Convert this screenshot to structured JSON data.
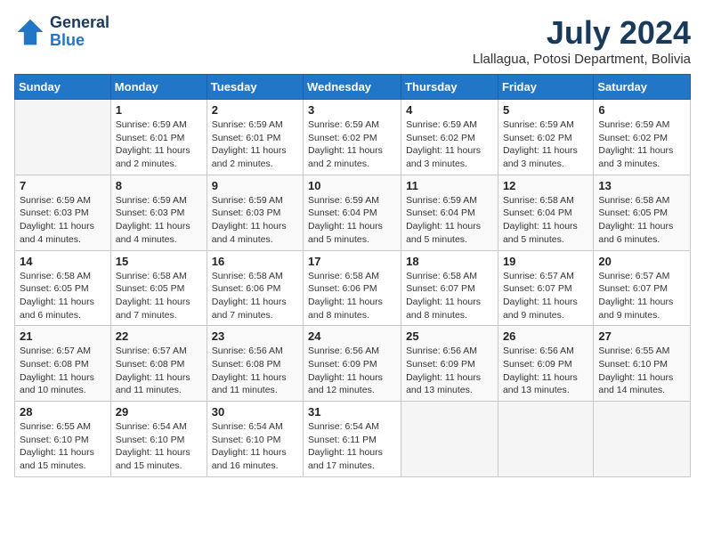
{
  "header": {
    "logo_general": "General",
    "logo_blue": "Blue",
    "month_title": "July 2024",
    "location": "Llallagua, Potosi Department, Bolivia"
  },
  "days_of_week": [
    "Sunday",
    "Monday",
    "Tuesday",
    "Wednesday",
    "Thursday",
    "Friday",
    "Saturday"
  ],
  "weeks": [
    [
      {
        "day": "",
        "info": ""
      },
      {
        "day": "1",
        "info": "Sunrise: 6:59 AM\nSunset: 6:01 PM\nDaylight: 11 hours\nand 2 minutes."
      },
      {
        "day": "2",
        "info": "Sunrise: 6:59 AM\nSunset: 6:01 PM\nDaylight: 11 hours\nand 2 minutes."
      },
      {
        "day": "3",
        "info": "Sunrise: 6:59 AM\nSunset: 6:02 PM\nDaylight: 11 hours\nand 2 minutes."
      },
      {
        "day": "4",
        "info": "Sunrise: 6:59 AM\nSunset: 6:02 PM\nDaylight: 11 hours\nand 3 minutes."
      },
      {
        "day": "5",
        "info": "Sunrise: 6:59 AM\nSunset: 6:02 PM\nDaylight: 11 hours\nand 3 minutes."
      },
      {
        "day": "6",
        "info": "Sunrise: 6:59 AM\nSunset: 6:02 PM\nDaylight: 11 hours\nand 3 minutes."
      }
    ],
    [
      {
        "day": "7",
        "info": "Sunrise: 6:59 AM\nSunset: 6:03 PM\nDaylight: 11 hours\nand 4 minutes."
      },
      {
        "day": "8",
        "info": "Sunrise: 6:59 AM\nSunset: 6:03 PM\nDaylight: 11 hours\nand 4 minutes."
      },
      {
        "day": "9",
        "info": "Sunrise: 6:59 AM\nSunset: 6:03 PM\nDaylight: 11 hours\nand 4 minutes."
      },
      {
        "day": "10",
        "info": "Sunrise: 6:59 AM\nSunset: 6:04 PM\nDaylight: 11 hours\nand 5 minutes."
      },
      {
        "day": "11",
        "info": "Sunrise: 6:59 AM\nSunset: 6:04 PM\nDaylight: 11 hours\nand 5 minutes."
      },
      {
        "day": "12",
        "info": "Sunrise: 6:58 AM\nSunset: 6:04 PM\nDaylight: 11 hours\nand 5 minutes."
      },
      {
        "day": "13",
        "info": "Sunrise: 6:58 AM\nSunset: 6:05 PM\nDaylight: 11 hours\nand 6 minutes."
      }
    ],
    [
      {
        "day": "14",
        "info": "Sunrise: 6:58 AM\nSunset: 6:05 PM\nDaylight: 11 hours\nand 6 minutes."
      },
      {
        "day": "15",
        "info": "Sunrise: 6:58 AM\nSunset: 6:05 PM\nDaylight: 11 hours\nand 7 minutes."
      },
      {
        "day": "16",
        "info": "Sunrise: 6:58 AM\nSunset: 6:06 PM\nDaylight: 11 hours\nand 7 minutes."
      },
      {
        "day": "17",
        "info": "Sunrise: 6:58 AM\nSunset: 6:06 PM\nDaylight: 11 hours\nand 8 minutes."
      },
      {
        "day": "18",
        "info": "Sunrise: 6:58 AM\nSunset: 6:07 PM\nDaylight: 11 hours\nand 8 minutes."
      },
      {
        "day": "19",
        "info": "Sunrise: 6:57 AM\nSunset: 6:07 PM\nDaylight: 11 hours\nand 9 minutes."
      },
      {
        "day": "20",
        "info": "Sunrise: 6:57 AM\nSunset: 6:07 PM\nDaylight: 11 hours\nand 9 minutes."
      }
    ],
    [
      {
        "day": "21",
        "info": "Sunrise: 6:57 AM\nSunset: 6:08 PM\nDaylight: 11 hours\nand 10 minutes."
      },
      {
        "day": "22",
        "info": "Sunrise: 6:57 AM\nSunset: 6:08 PM\nDaylight: 11 hours\nand 11 minutes."
      },
      {
        "day": "23",
        "info": "Sunrise: 6:56 AM\nSunset: 6:08 PM\nDaylight: 11 hours\nand 11 minutes."
      },
      {
        "day": "24",
        "info": "Sunrise: 6:56 AM\nSunset: 6:09 PM\nDaylight: 11 hours\nand 12 minutes."
      },
      {
        "day": "25",
        "info": "Sunrise: 6:56 AM\nSunset: 6:09 PM\nDaylight: 11 hours\nand 13 minutes."
      },
      {
        "day": "26",
        "info": "Sunrise: 6:56 AM\nSunset: 6:09 PM\nDaylight: 11 hours\nand 13 minutes."
      },
      {
        "day": "27",
        "info": "Sunrise: 6:55 AM\nSunset: 6:10 PM\nDaylight: 11 hours\nand 14 minutes."
      }
    ],
    [
      {
        "day": "28",
        "info": "Sunrise: 6:55 AM\nSunset: 6:10 PM\nDaylight: 11 hours\nand 15 minutes."
      },
      {
        "day": "29",
        "info": "Sunrise: 6:54 AM\nSunset: 6:10 PM\nDaylight: 11 hours\nand 15 minutes."
      },
      {
        "day": "30",
        "info": "Sunrise: 6:54 AM\nSunset: 6:10 PM\nDaylight: 11 hours\nand 16 minutes."
      },
      {
        "day": "31",
        "info": "Sunrise: 6:54 AM\nSunset: 6:11 PM\nDaylight: 11 hours\nand 17 minutes."
      },
      {
        "day": "",
        "info": ""
      },
      {
        "day": "",
        "info": ""
      },
      {
        "day": "",
        "info": ""
      }
    ]
  ]
}
